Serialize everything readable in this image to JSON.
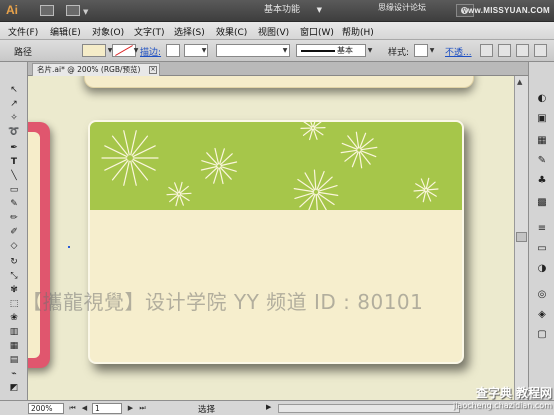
{
  "appbar": {
    "logo": "Ai",
    "workspace_label": "基本功能",
    "site_label": "思缘设计论坛",
    "watermark": "www.MISSYUAN.COM"
  },
  "menu": [
    "文件(F)",
    "编辑(E)",
    "对象(O)",
    "文字(T)",
    "选择(S)",
    "效果(C)",
    "视图(V)",
    "窗口(W)",
    "帮助(H)"
  ],
  "control": {
    "object_label": "路径",
    "stroke_link": "描边:",
    "line_style_label": "基本",
    "style_label": "样式:",
    "opacity_link": "不透..."
  },
  "document": {
    "tab_label": "名片.ai* @ 200% (RGB/预览)",
    "tab_close": "×"
  },
  "canvas": {
    "watermark_text": "【攜龍視覺】设计学院  YY 频道 ID : 80101",
    "colors": {
      "green": "#a6c64a",
      "cream": "#f6eecd",
      "pink": "#e0566e",
      "background": "#eceace"
    }
  },
  "statusbar": {
    "zoom": "200%",
    "page": "1",
    "status_text": "选择"
  },
  "footer_watermark": {
    "line1": "查字典 教程网",
    "line2": "jiaocheng.chazidian.com"
  },
  "tools": [
    "selection-tool",
    "direct-selection-tool",
    "magic-wand-tool",
    "pen-tool",
    "type-tool",
    "line-tool",
    "rectangle-tool",
    "paintbrush-tool",
    "pencil-tool",
    "blob-brush-tool",
    "eraser-tool",
    "rotate-tool",
    "scale-tool",
    "warp-tool",
    "free-transform-tool",
    "symbol-sprayer-tool",
    "graph-tool",
    "mesh-tool",
    "gradient-tool",
    "eyedropper-tool",
    "hand-tool",
    "zoom-tool"
  ],
  "right_panels": [
    "color-panel-icon",
    "color-guide-icon",
    "swatches-icon",
    "brushes-icon",
    "symbols-icon",
    "graphic-styles-icon",
    "stroke-icon",
    "gradient-icon",
    "transparency-icon",
    "appearance-icon",
    "layers-icon",
    "artboards-icon"
  ]
}
